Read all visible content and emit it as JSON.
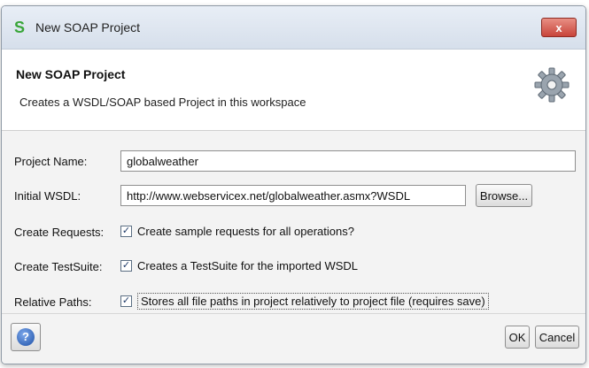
{
  "window": {
    "title": "New SOAP Project",
    "app_icon": "soapui-s-icon",
    "close_label": "x"
  },
  "header": {
    "title": "New SOAP Project",
    "description": "Creates a WSDL/SOAP based Project in this workspace",
    "icon": "gear-icon"
  },
  "form": {
    "project_name_label": "Project Name:",
    "project_name_value": "globalweather",
    "initial_wsdl_label": "Initial WSDL:",
    "initial_wsdl_value": "http://www.webservicex.net/globalweather.asmx?WSDL",
    "browse_label": "Browse...",
    "create_requests_label": "Create Requests:",
    "create_requests_text": "Create sample requests for all operations?",
    "create_requests_checked": true,
    "create_testsuite_label": "Create TestSuite:",
    "create_testsuite_text": "Creates a TestSuite for the imported WSDL",
    "create_testsuite_checked": true,
    "relative_paths_label": "Relative Paths:",
    "relative_paths_text": "Stores all file paths in project relatively to project file (requires save)",
    "relative_paths_checked": true,
    "check_mark": "✓"
  },
  "footer": {
    "help_icon": "help-icon",
    "help_glyph": "?",
    "ok_label": "OK",
    "cancel_label": "Cancel"
  },
  "colors": {
    "titlebar": "#d6dfeb",
    "close_button": "#c8443a",
    "help_icon": "#1c4fa6"
  }
}
